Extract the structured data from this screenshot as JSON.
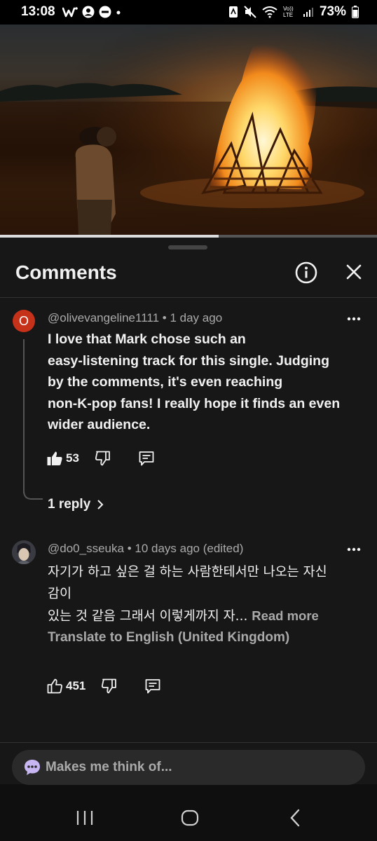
{
  "status_bar": {
    "time": "13:08",
    "battery": "73%",
    "network": "Vo)) LTE"
  },
  "video": {
    "progress": 0.58
  },
  "sheet": {
    "title": "Comments",
    "icons": {
      "info": "info-icon",
      "close": "close-icon"
    }
  },
  "comments": [
    {
      "author": "@olivevangeline1111",
      "time": "1 day ago",
      "avatar_letter": "O",
      "avatar_color": "#c6311a",
      "text_lines": [
        "I love that Mark chose such an",
        "easy-listening track for this single. Judging",
        "by the comments, it's even reaching",
        "non-K-pop fans! I really hope it finds an even",
        "wider audience."
      ],
      "likes": "53",
      "replies_label": "1 reply"
    },
    {
      "author": "@do0_sseuka",
      "time": "10 days ago (edited)",
      "text_lines": [
        "자기가 하고 싶은 걸 하는 사람한테서만 나오는 자신",
        "감이",
        "있는 것 같음 그래서 이렇게까지 자..."
      ],
      "read_more": "Read more",
      "translate": "Translate to English (United Kingdom)",
      "likes": "451"
    }
  ],
  "compose": {
    "placeholder": "Makes me think of..."
  },
  "colors": {
    "background": "#0f0f0f",
    "sheet": "#171717",
    "muted_text": "#aaaaaa"
  }
}
